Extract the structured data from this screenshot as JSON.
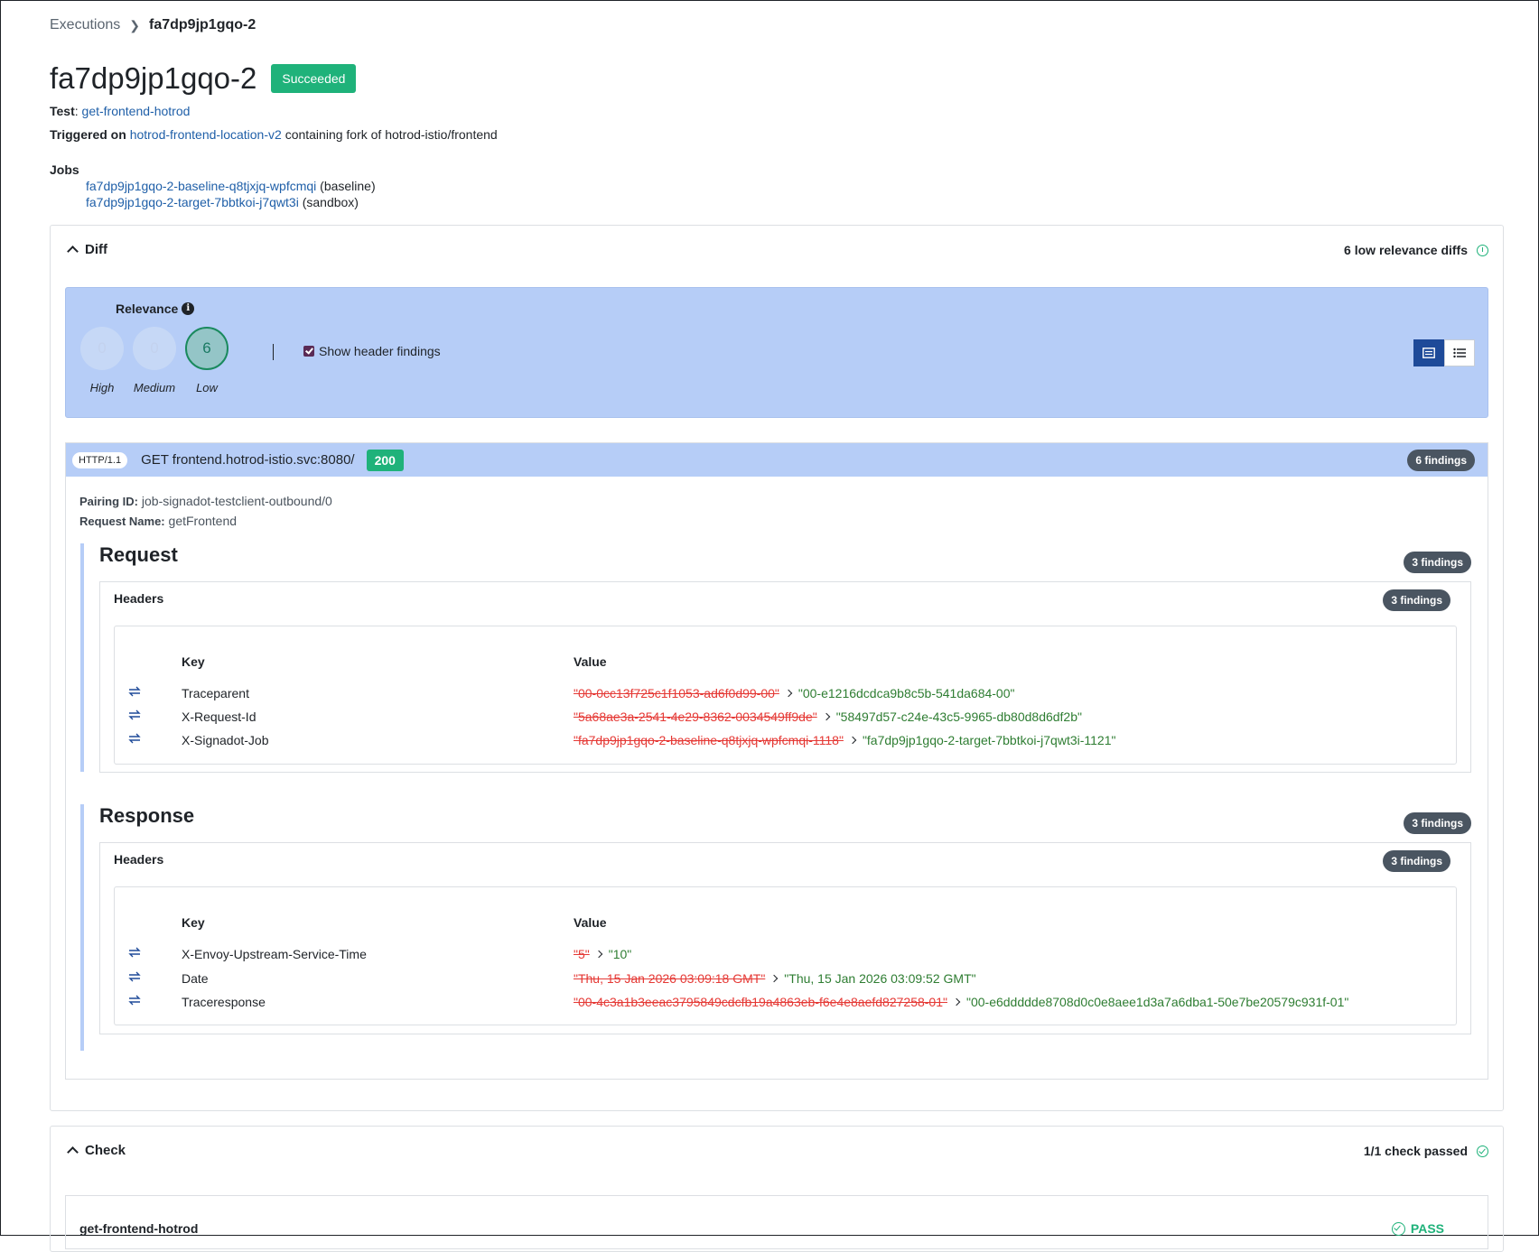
{
  "breadcrumb": {
    "parent": "Executions",
    "current": "fa7dp9jp1gqo-2"
  },
  "title": "fa7dp9jp1gqo-2",
  "status": "Succeeded",
  "test": {
    "label": "Test",
    "name": "get-frontend-hotrod"
  },
  "triggered": {
    "label": "Triggered on",
    "sandbox": "hotrod-frontend-location-v2",
    "suffix": "containing fork of hotrod-istio/frontend"
  },
  "jobs": {
    "label": "Jobs",
    "items": [
      {
        "name": "fa7dp9jp1gqo-2-baseline-q8tjxjq-wpfcmqi",
        "role": "(baseline)"
      },
      {
        "name": "fa7dp9jp1gqo-2-target-7bbtkoi-j7qwt3i",
        "role": "(sandbox)"
      }
    ]
  },
  "diff": {
    "label": "Diff",
    "summary": "6 low relevance diffs",
    "relevance": {
      "title": "Relevance",
      "info": "i",
      "high": {
        "count": "0",
        "label": "High"
      },
      "medium": {
        "count": "0",
        "label": "Medium"
      },
      "low": {
        "count": "6",
        "label": "Low"
      },
      "show_header_findings": "Show header findings"
    },
    "request": {
      "protocol": "HTTP/1.1",
      "line": "GET frontend.hotrod-istio.svc:8080/",
      "status_code": "200",
      "findings": "6 findings",
      "pairing_label": "Pairing ID:",
      "pairing_id": "job-signadot-testclient-outbound/0",
      "name_label": "Request Name:",
      "name": "getFrontend"
    },
    "request_section": {
      "title": "Request",
      "findings": "3 findings",
      "headers_title": "Headers",
      "headers_findings": "3 findings",
      "key_header": "Key",
      "value_header": "Value",
      "rows": [
        {
          "key": "Traceparent",
          "old": "\"00-0cc13f725c1f1053-ad6f0d99-00\"",
          "new": "\"00-e1216dcdca9b8c5b-541da684-00\""
        },
        {
          "key": "X-Request-Id",
          "old": "\"5a68ae3a-2541-4e29-8362-0034549ff9de\"",
          "new": "\"58497d57-c24e-43c5-9965-db80d8d6df2b\""
        },
        {
          "key": "X-Signadot-Job",
          "old": "\"fa7dp9jp1gqo-2-baseline-q8tjxjq-wpfcmqi-1118\"",
          "new": "\"fa7dp9jp1gqo-2-target-7bbtkoi-j7qwt3i-1121\""
        }
      ]
    },
    "response_section": {
      "title": "Response",
      "findings": "3 findings",
      "headers_title": "Headers",
      "headers_findings": "3 findings",
      "key_header": "Key",
      "value_header": "Value",
      "rows": [
        {
          "key": "X-Envoy-Upstream-Service-Time",
          "old": "\"5\"",
          "new": "\"10\""
        },
        {
          "key": "Date",
          "old": "\"Thu, 15 Jan 2026 03:09:18 GMT\"",
          "new": "\"Thu, 15 Jan 2026 03:09:52 GMT\""
        },
        {
          "key": "Traceresponse",
          "old": "\"00-4c3a1b3eeac3795849cdcfb19a4863eb-f6e4e8aefd827258-01\"",
          "new": "\"00-e6ddddde8708d0c0e8aee1d3a7a6dba1-50e7be20579c931f-01\""
        }
      ]
    }
  },
  "check": {
    "label": "Check",
    "summary": "1/1 check passed",
    "item_name": "get-frontend-hotrod",
    "result": "PASS"
  },
  "colors": {
    "accent_green": "#1fb27a",
    "link_blue": "#1f5fa8",
    "panel_blue": "#b6cdf7",
    "removed_red": "#e53935",
    "added_green": "#2e7d32"
  }
}
